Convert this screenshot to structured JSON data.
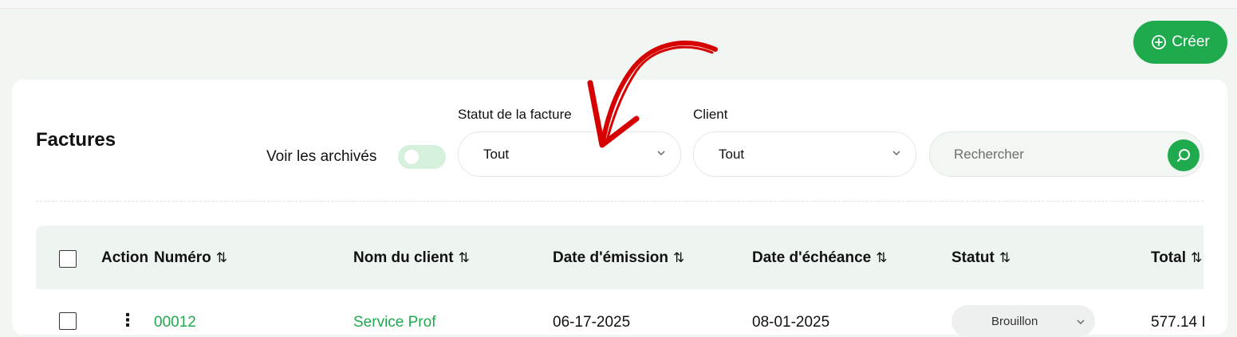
{
  "header": {
    "create_label": "Créer"
  },
  "card": {
    "title": "Factures",
    "archive_toggle_label": "Voir les archivés",
    "filters": {
      "status": {
        "label": "Statut de la facture",
        "value": "Tout"
      },
      "client": {
        "label": "Client",
        "value": "Tout"
      },
      "search": {
        "placeholder": "Rechercher"
      }
    },
    "table": {
      "columns": [
        "Action",
        "Numéro",
        "Nom du client",
        "Date d'émission",
        "Date d'échéance",
        "Statut",
        "Total"
      ],
      "sort_icon": "⇅",
      "rows": [
        {
          "number": "00012",
          "client": "Service Prof",
          "issue_date": "06-17-2025",
          "due_date": "08-01-2025",
          "status": "Brouillon",
          "total": "577.14 I"
        }
      ]
    }
  },
  "colors": {
    "accent": "#1faa4d",
    "annotation_arrow": "#d60000"
  }
}
